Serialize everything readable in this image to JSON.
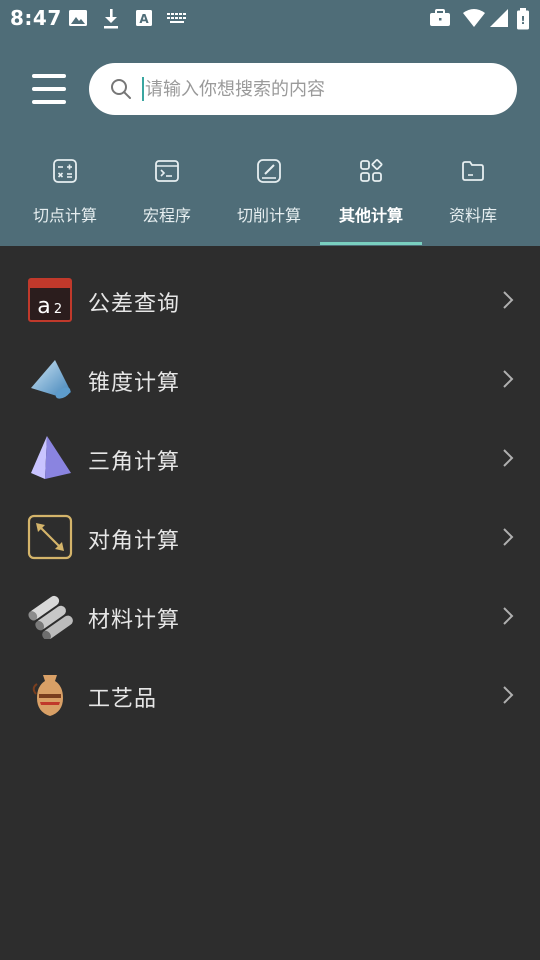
{
  "status_bar": {
    "time": "8:47",
    "left_icons": [
      "image-icon",
      "download-icon",
      "a-font-icon",
      "keyboard-icon"
    ],
    "right_icons": [
      "briefcase-icon",
      "wifi-icon",
      "signal-icon",
      "battery-icon"
    ]
  },
  "header": {
    "menu_icon": "menu-icon",
    "search": {
      "placeholder": "请输入你想搜索的内容",
      "value": ""
    }
  },
  "tabs": [
    {
      "label": "切点计算",
      "icon": "calculator-icon",
      "active": false
    },
    {
      "label": "宏程序",
      "icon": "terminal-icon",
      "active": false
    },
    {
      "label": "切削计算",
      "icon": "edit-icon",
      "active": false
    },
    {
      "label": "其他计算",
      "icon": "grid-icon",
      "active": true
    },
    {
      "label": "资料库",
      "icon": "folder-icon",
      "active": false
    }
  ],
  "list": [
    {
      "label": "公差查询",
      "icon": "a2-calendar-icon"
    },
    {
      "label": "锥度计算",
      "icon": "cone-icon"
    },
    {
      "label": "三角计算",
      "icon": "pyramid-icon"
    },
    {
      "label": "对角计算",
      "icon": "diagonal-arrow-icon"
    },
    {
      "label": "材料计算",
      "icon": "pipes-icon"
    },
    {
      "label": "工艺品",
      "icon": "vase-icon"
    }
  ],
  "colors": {
    "header_bg": "#4f6d78",
    "body_bg": "#2d2d2d",
    "indicator": "#7ad0c0",
    "text": "#e6e6e6"
  }
}
